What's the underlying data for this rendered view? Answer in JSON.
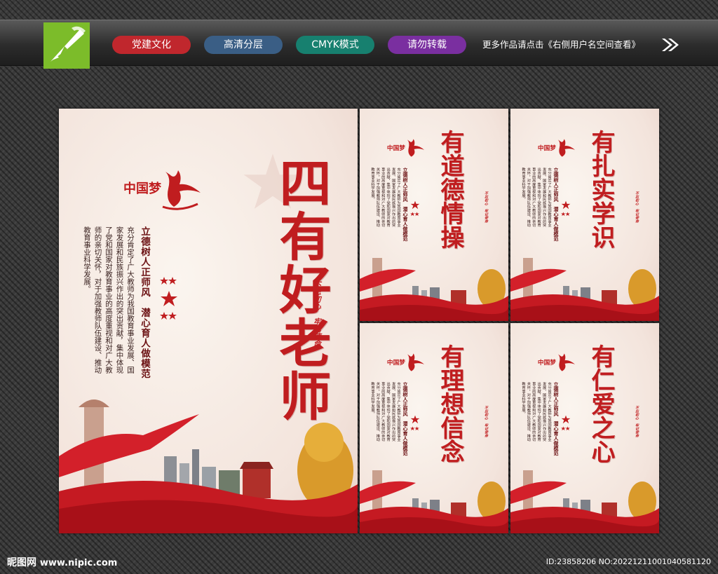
{
  "toolbar": {
    "tags": [
      "党建文化",
      "高清分层",
      "CMYK模式",
      "请勿转载"
    ],
    "more_text": "更多作品请点击《右侧用户名空间查看》"
  },
  "colors": {
    "accent_red": "#c01d1f",
    "toolbar_green": "#7cbc2a",
    "tag_red": "#c0272d",
    "tag_blue": "#3a5e85",
    "tag_teal": "#17806f",
    "tag_purple": "#7a2fa0"
  },
  "poster_common": {
    "logo_text": "中国梦",
    "slogan": "立德树人正师风　潜心育人做模范",
    "body": "充分肯定了广大教师为我国教育事业发展、国家发展和民族振兴作出的突出贡献，集中体现了党和国家对教育事业的高度重视和对广大教师的亲切关怀，对于加强教师队伍建设、推动教育事业科学发展。",
    "seal": "不忘初心　牢记使命"
  },
  "posters": {
    "main": {
      "title": "四有好老师"
    },
    "s1": {
      "title": "有道德情操"
    },
    "s2": {
      "title": "有扎实学识"
    },
    "s3": {
      "title": "有理想信念"
    },
    "s4": {
      "title": "有仁爱之心"
    }
  },
  "footer": {
    "site_cn": "昵图网",
    "site_url": "www.nipic.com",
    "id_text": "ID:23858206 NO:20221211001040581120"
  }
}
